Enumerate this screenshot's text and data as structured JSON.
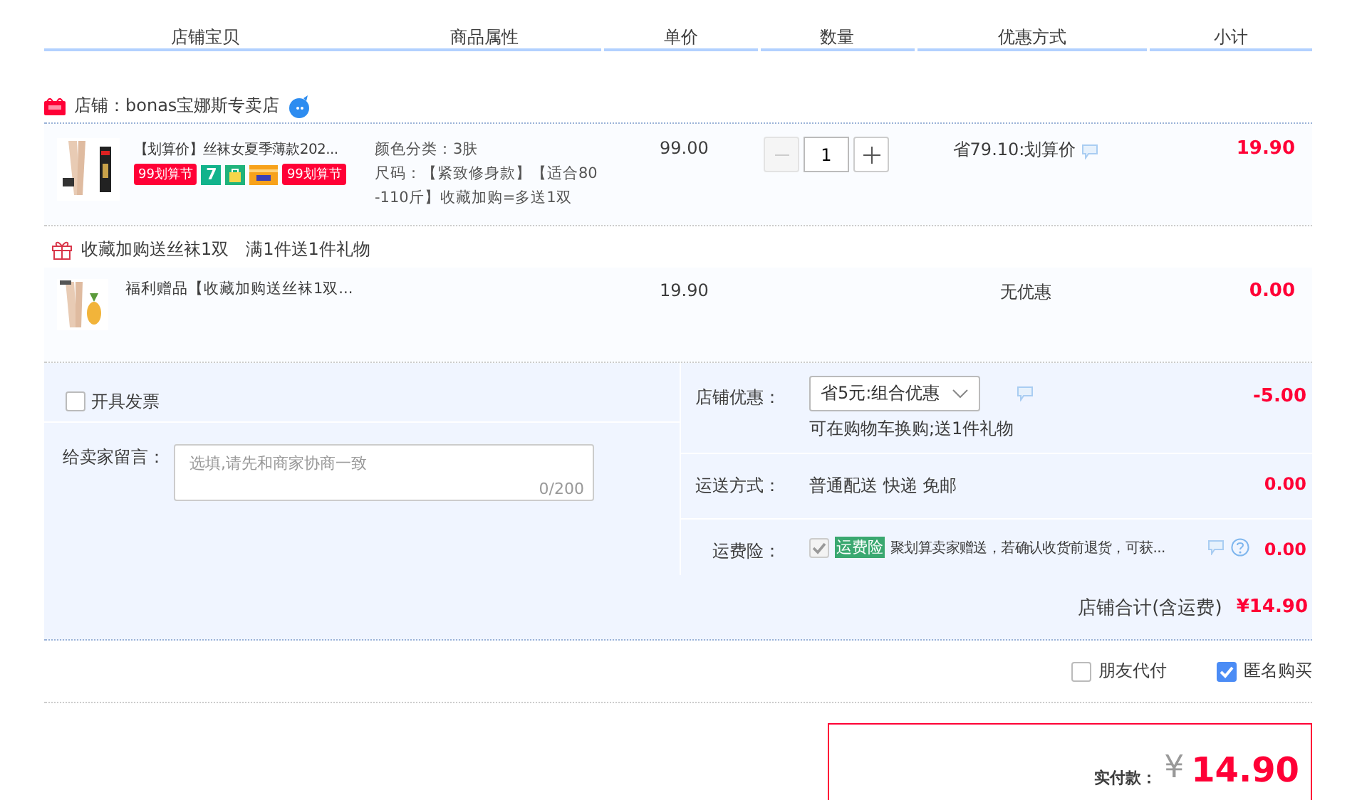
{
  "columns": [
    "店铺宝贝",
    "商品属性",
    "单价",
    "数量",
    "优惠方式",
    "小计"
  ],
  "shop": {
    "name": "店铺：bonas宝娜斯专卖店"
  },
  "item": {
    "title": "【划算价】丝袜女夏季薄款202...",
    "badges": [
      {
        "kind": "promo",
        "label": "99划算节"
      },
      {
        "kind": "seven",
        "label": "7"
      },
      {
        "kind": "bag"
      },
      {
        "kind": "card"
      },
      {
        "kind": "promo",
        "label": "99划算节"
      }
    ],
    "attributes": [
      "颜色分类：3肤",
      "尺码：【紧致修身款】【适合80-110斤】收藏加购=多送1双"
    ],
    "price": "99.00",
    "quantity": "1",
    "discount": "省79.10:划算价",
    "subtotal": "19.90"
  },
  "gift_promo": [
    "收藏加购送丝袜1双",
    "满1件送1件礼物"
  ],
  "gift_item": {
    "title": "福利赠品【收藏加购送丝袜1双...",
    "price": "19.90",
    "discount": "无优惠",
    "subtotal": "0.00"
  },
  "invoice": {
    "label": "开具发票",
    "checked": false
  },
  "message": {
    "label": "给卖家留言：",
    "placeholder": "选填,请先和商家协商一致",
    "counter": "0/200"
  },
  "store_discount": {
    "label": "店铺优惠：",
    "value": "省5元:组合优惠",
    "note": "可在购物车换购;送1件礼物",
    "amount": "-5.00"
  },
  "shipping": {
    "label": "运送方式：",
    "value": "普通配送 快递 免邮",
    "amount": "0.00"
  },
  "insurance": {
    "label": "运费险：",
    "checked": true,
    "tag": "运费险",
    "text": "聚划算卖家赠送，若确认收货前退货，可获...",
    "amount": "0.00"
  },
  "shop_total": {
    "label": "店铺合计(含运费)",
    "amount": "¥14.90"
  },
  "options": [
    {
      "label": "朋友代付",
      "checked": false
    },
    {
      "label": "匿名购买",
      "checked": true
    }
  ],
  "payment": {
    "label": "实付款：",
    "currency": "¥",
    "amount": "14.90"
  }
}
